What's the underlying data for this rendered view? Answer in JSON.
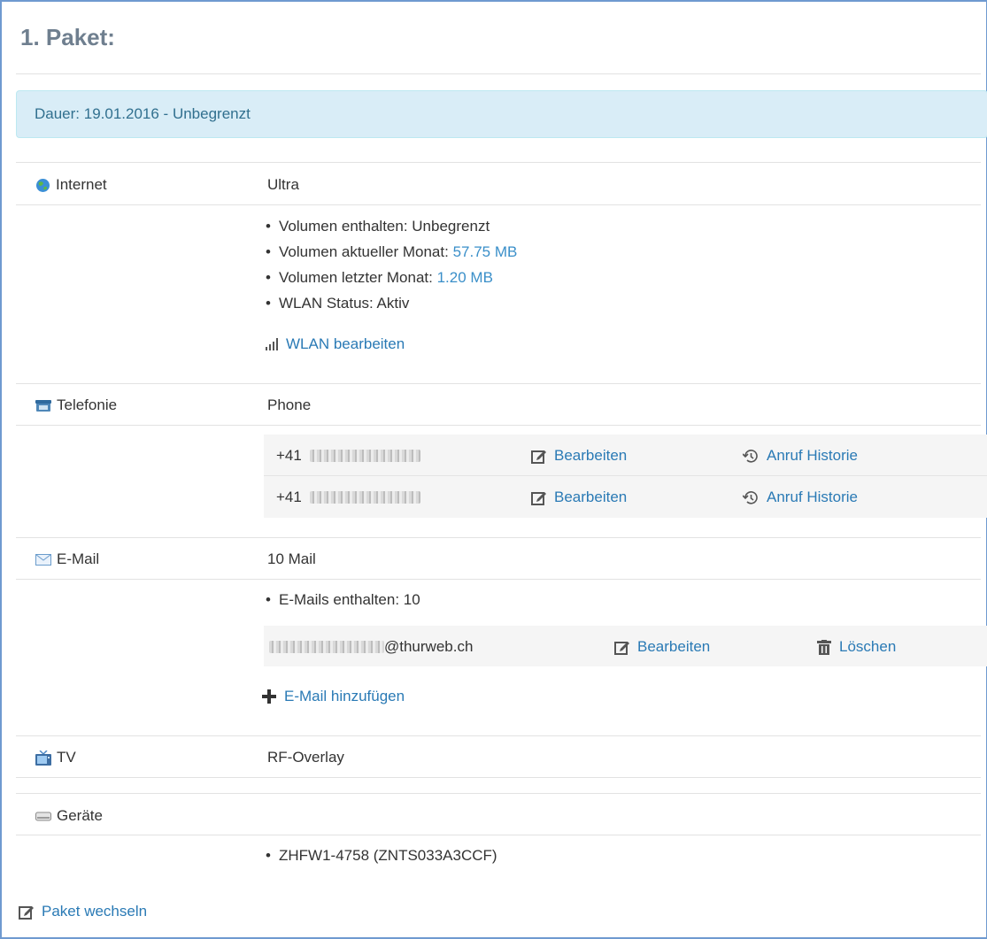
{
  "header": {
    "title": "1. Paket:"
  },
  "duration": {
    "text": "Dauer: 19.01.2016 - Unbegrenzt"
  },
  "internet": {
    "label": "Internet",
    "value": "Ultra",
    "details": [
      {
        "text": "Volumen enthalten: Unbegrenzt",
        "value": ""
      },
      {
        "text": "Volumen aktueller Monat: ",
        "value": "57.75 MB"
      },
      {
        "text": "Volumen letzter Monat: ",
        "value": "1.20 MB"
      },
      {
        "text": "WLAN Status: Aktiv",
        "value": ""
      }
    ],
    "wlan_link": "WLAN bearbeiten"
  },
  "telefonie": {
    "label": "Telefonie",
    "value": "Phone",
    "numbers": [
      {
        "prefix": "+41",
        "edit": "Bearbeiten",
        "history": "Anruf Historie"
      },
      {
        "prefix": "+41",
        "edit": "Bearbeiten",
        "history": "Anruf Historie"
      }
    ]
  },
  "email": {
    "label": "E-Mail",
    "value": "10 Mail",
    "details": [
      "E-Mails enthalten: 10"
    ],
    "accounts": [
      {
        "domain": "@thurweb.ch",
        "edit": "Bearbeiten",
        "delete": "Löschen"
      }
    ],
    "add_link": "E-Mail hinzufügen"
  },
  "tv": {
    "label": "TV",
    "value": "RF-Overlay"
  },
  "geraete": {
    "label": "Geräte",
    "devices": [
      "ZHFW1-4758 (ZNTS033A3CCF)"
    ]
  },
  "footer": {
    "change_package": "Paket wechseln"
  },
  "colors": {
    "link": "#2a7ab5",
    "alert_bg": "#d9edf7",
    "alert_text": "#31708f",
    "title": "#6f7f8f"
  },
  "icons": [
    "globe-icon",
    "signal-icon",
    "phone-icon",
    "edit-icon",
    "history-icon",
    "envelope-icon",
    "trash-icon",
    "plus-icon",
    "tv-icon",
    "device-icon"
  ]
}
